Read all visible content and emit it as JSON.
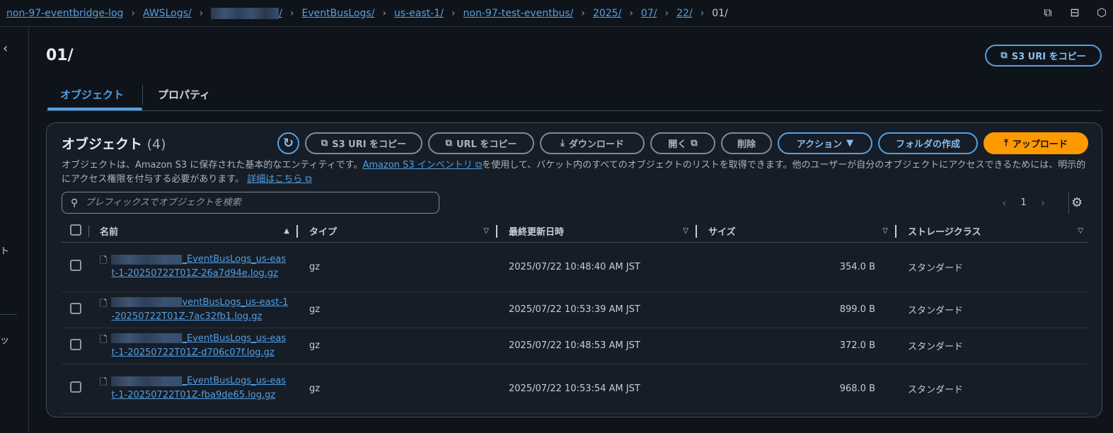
{
  "breadcrumb": [
    {
      "label": "non-97-eventbridge-log",
      "redacted": false
    },
    {
      "label": "AWSLogs/",
      "redacted": false
    },
    {
      "label": "/",
      "redacted": true
    },
    {
      "label": "EventBusLogs/",
      "redacted": false
    },
    {
      "label": "us-east-1/",
      "redacted": false
    },
    {
      "label": "non-97-test-eventbus/",
      "redacted": false
    },
    {
      "label": "2025/",
      "redacted": false
    },
    {
      "label": "07/",
      "redacted": false
    },
    {
      "label": "22/",
      "redacted": false
    },
    {
      "label": "01/",
      "redacted": false,
      "current": true
    }
  ],
  "page": {
    "title": "01/",
    "copy_uri_label": "S3 URI をコピー"
  },
  "tabs": [
    "オブジェクト",
    "プロパティ"
  ],
  "left_nav_fragments": [
    "ト",
    "ッ"
  ],
  "objects": {
    "heading": "オブジェクト",
    "count": "(4)",
    "buttons": {
      "copy_s3_uri": "S3 URI をコピー",
      "copy_url": "URL をコピー",
      "download": "ダウンロード",
      "open": "開く",
      "delete": "削除",
      "actions": "アクション",
      "create_folder": "フォルダの作成",
      "upload": "アップロード"
    },
    "description_1": "オブジェクトは、Amazon S3 に保存された基本的なエンティティです。",
    "inventory_link": "Amazon S3 インベントリ",
    "description_2": "を使用して、バケット内のすべてのオブジェクトのリストを取得できます。他のユーザーが自分のオブジェクトにアクセスできるためには、明示的にアクセス権限を付与する必要があります。",
    "details_link": "詳細はこちら",
    "search_placeholder": "プレフィックスでオブジェクトを検索",
    "page_number": "1",
    "columns": [
      "名前",
      "タイプ",
      "最終更新日時",
      "サイズ",
      "ストレージクラス"
    ],
    "rows": [
      {
        "name_visible": "_EventBusLogs_us-east-1-20250722T01Z-26a7d94e.log.gz",
        "type": "gz",
        "modified": "2025/07/22 10:48:40 AM JST",
        "size": "354.0 B",
        "storage": "スタンダード"
      },
      {
        "name_visible": "ventBusLogs_us-east-1-20250722T01Z-7ac32fb1.log.gz",
        "type": "gz",
        "modified": "2025/07/22 10:53:39 AM JST",
        "size": "899.0 B",
        "storage": "スタンダード"
      },
      {
        "name_visible": "_EventBusLogs_us-east-1-20250722T01Z-d706c07f.log.gz",
        "type": "gz",
        "modified": "2025/07/22 10:48:53 AM JST",
        "size": "372.0 B",
        "storage": "スタンダード"
      },
      {
        "name_visible": "_EventBusLogs_us-east-1-20250722T01Z-fba9de65.log.gz",
        "type": "gz",
        "modified": "2025/07/22 10:53:54 AM JST",
        "size": "968.0 B",
        "storage": "スタンダード"
      }
    ]
  },
  "colors": {
    "accent": "#539fe5",
    "upload": "#ff9900",
    "background": "#0f141a"
  }
}
